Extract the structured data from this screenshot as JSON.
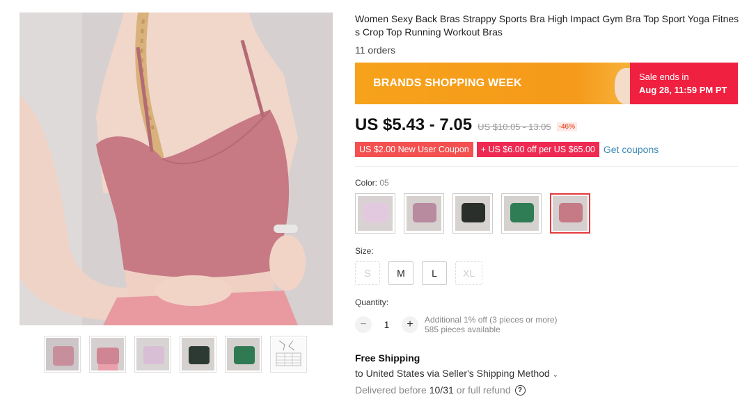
{
  "product": {
    "title": "Women Sexy Back Bras Strappy Sports Bra High Impact Gym Bra Top Sport Yoga Fitness Crop Top Running Workout Bras",
    "orders": "11 orders"
  },
  "gallery": {
    "main_image_icon": "product-photo-pink-sports-bra",
    "thumbnails": [
      {
        "icon": "thumb-pink-back",
        "color": "#c78f9c"
      },
      {
        "icon": "thumb-pink-back-strappy",
        "color": "#cf8593"
      },
      {
        "icon": "thumb-lavender-front",
        "color": "#d8bfd6"
      },
      {
        "icon": "thumb-black-front",
        "color": "#2d3a34"
      },
      {
        "icon": "thumb-green-front",
        "color": "#2f7a52"
      },
      {
        "icon": "thumb-size-chart",
        "color": "#f4f4f4"
      }
    ]
  },
  "banner": {
    "title": "BRANDS SHOPPING WEEK",
    "sale_ends_label": "Sale ends in",
    "sale_date": "Aug 28, 11:59 PM PT"
  },
  "pricing": {
    "price": "US $5.43 - 7.05",
    "original_price": "US $10.05 - 13.05",
    "discount": "-46%"
  },
  "coupons": {
    "new_user": "US $2.00 New User Coupon",
    "store": "+ US $6.00 off per US $65.00",
    "get_coupons": "Get coupons"
  },
  "color": {
    "label": "Color:",
    "selected": "05",
    "swatches": [
      {
        "icon": "swatch-lavender",
        "color": "#e2c9df"
      },
      {
        "icon": "swatch-mauve",
        "color": "#b98b9f"
      },
      {
        "icon": "swatch-black",
        "color": "#2b2f2c"
      },
      {
        "icon": "swatch-green",
        "color": "#2e7d54"
      },
      {
        "icon": "swatch-pink",
        "color": "#c57a86"
      }
    ]
  },
  "size": {
    "label": "Size:",
    "options": [
      {
        "label": "S",
        "available": false
      },
      {
        "label": "M",
        "available": true
      },
      {
        "label": "L",
        "available": true
      },
      {
        "label": "XL",
        "available": false
      }
    ]
  },
  "quantity": {
    "label": "Quantity:",
    "value": "1",
    "minus": "−",
    "plus": "+",
    "note_discount": "Additional 1% off (3 pieces or more)",
    "note_available": "585 pieces available"
  },
  "shipping": {
    "title": "Free Shipping",
    "to": "to United States via Seller's Shipping Method",
    "chevron": "⌄",
    "delivered_prefix": "Delivered before",
    "delivered_date": "10/31",
    "delivered_suffix": "or full refund",
    "help_icon": "?"
  },
  "colors": {
    "brand_orange": "#f59a1a",
    "sale_red": "#ef2040",
    "link_blue": "#3c8ab7",
    "selected_border": "#e4393c"
  }
}
